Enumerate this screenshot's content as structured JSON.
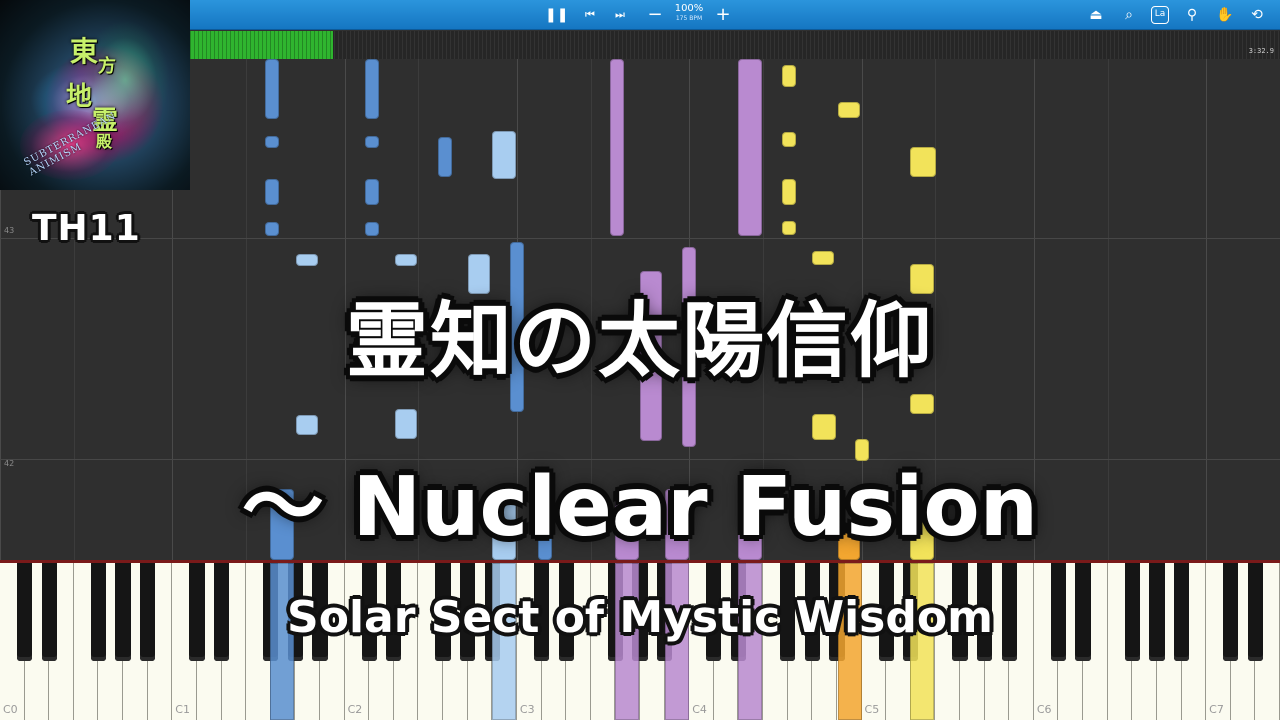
{
  "toolbar": {
    "pause_icon": "pause-icon",
    "prev_icon": "skip-back-icon",
    "next_icon": "skip-forward-icon",
    "zoom_out_icon": "minus-icon",
    "zoom_in_icon": "plus-icon",
    "zoom_percent": "100%",
    "tempo": "175 BPM",
    "tools": [
      "metronome-icon",
      "search-icon",
      "label-icon",
      "map-marker-icon",
      "hand-icon",
      "loop-icon"
    ]
  },
  "progress": {
    "fraction": 0.131,
    "time": "3:32.9"
  },
  "measures": [
    "43",
    "42"
  ],
  "cover": {
    "chars": [
      "東",
      "方",
      "地",
      "霊",
      "殿"
    ],
    "subtitle": "SUBTERRANEAN ANIMISM"
  },
  "game_tag": "TH11",
  "title_jp": "霊知の太陽信仰",
  "title_en": "～ Nuclear Fusion",
  "subtitle": "Solar Sect of Mystic Wisdom",
  "keyboard": {
    "octave_labels": [
      "C0",
      "C1",
      "C2",
      "C3",
      "C4",
      "C5",
      "C6",
      "C7"
    ]
  },
  "colors": {
    "blue": "#5a8fd0",
    "light_blue": "#a8cdf0",
    "purple": "#b98ad0",
    "yellow": "#f2e35a",
    "orange": "#f3a630",
    "toolbar": "#1f86cf",
    "progress": "#2fb52f"
  }
}
